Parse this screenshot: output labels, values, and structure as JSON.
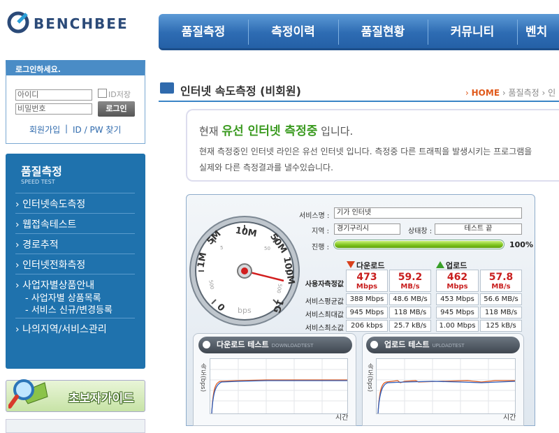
{
  "logo": {
    "text": "BENCHBEE"
  },
  "nav": {
    "items": [
      "품질측정",
      "측정이력",
      "품질현황",
      "커뮤니티",
      "벤치"
    ]
  },
  "login": {
    "title": "로그인하세요.",
    "id_placeholder": "아이디",
    "pw_placeholder": "비밀번호",
    "save_label": "ID저장",
    "button": "로그인",
    "join": "회원가입",
    "separator": "|",
    "find": "ID / PW 찾기"
  },
  "sidemenu": {
    "title": "품질측정",
    "subtitle": "SPEED TEST",
    "items": [
      "인터넷속도측정",
      "웹접속테스트",
      "경로추적",
      "인터넷전화측정",
      "사업자별상품안내"
    ],
    "subitems": [
      "- 사업자별 상품목록",
      "- 서비스 신규/변경등록"
    ],
    "last": "나의지역/서비스관리"
  },
  "guide": {
    "label": "초보자가이드"
  },
  "page": {
    "title": "인터넷 속도측정 (비회원)"
  },
  "breadcrumb": {
    "home": "HOME",
    "sep1": "›",
    "item1": "품질측정",
    "sep2": "›",
    "item2": "인"
  },
  "notice": {
    "prefix": "현재",
    "highlight": "유선 인터넷 측정중",
    "suffix": "입니다.",
    "line1": "현재 측정중인 인터넷 라인은 유선 인터넷 입니다. 측정중 다른 트래픽을 발생시키는 프로그램을",
    "line2": "실제와 다른 측정결과를 낼수있습니다."
  },
  "gauge": {
    "labels": [
      "0",
      "1M",
      "5M",
      "10M",
      "50M",
      "100M",
      "1G"
    ],
    "small_labels": [
      "500",
      "5",
      "50",
      "500"
    ],
    "unit": "bps"
  },
  "info": {
    "service_label": "서비스명 :",
    "service_value": "기가 인터넷",
    "region_label": "지역 :",
    "region_value": "경기구리시",
    "status_label": "상태창 :",
    "status_value": "테스트 끝",
    "progress_label": "진행 :",
    "progress_percent": 100,
    "progress_text": "100%"
  },
  "results": {
    "download_head": "다운로드",
    "upload_head": "업로드",
    "row_labels": [
      "사용자측정값",
      "서비스평균값",
      "서비스최대값",
      "서비스최소값"
    ],
    "user": {
      "download_mbps": "473",
      "download_mbs": "59.2",
      "upload_mbps": "462",
      "upload_mbs": "57.8",
      "unit_mbps": "Mbps",
      "unit_mbs": "MB/s"
    },
    "rows": [
      [
        "388 Mbps",
        "48.6 MB/s",
        "453 Mbps",
        "56.6 MB/s"
      ],
      [
        "945 Mbps",
        "118 MB/s",
        "945 Mbps",
        "118 MB/s"
      ],
      [
        "206 kbps",
        "25.7 kB/s",
        "1.00 Mbps",
        "125 kB/s"
      ]
    ],
    "colors": {
      "down_arrow": "#d8401c",
      "up_arrow": "#3aa02a",
      "value_red": "#c81e1e"
    }
  },
  "graphs": {
    "download_title": "다운로드 테스트",
    "download_sub": "DOWNLOADTEST",
    "upload_title": "업로드 테스트",
    "upload_sub": "UPLOADTEST",
    "y_label": "속도(bps)",
    "x_label": "시간"
  }
}
